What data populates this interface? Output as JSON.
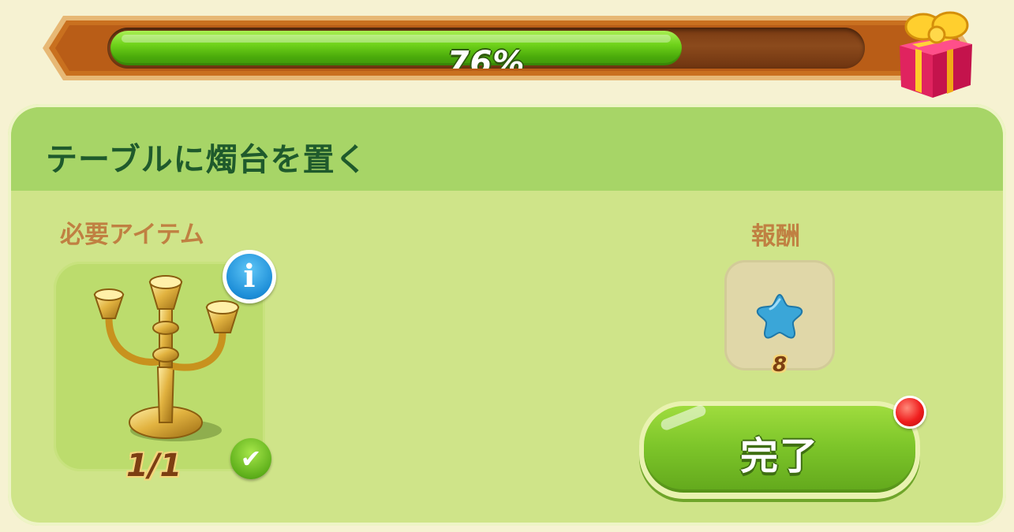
{
  "progress": {
    "percent_text": "76%",
    "fraction": 0.76
  },
  "task": {
    "title": "テーブルに燭台を置く",
    "required_items_label": "必要アイテム",
    "reward_label": "報酬",
    "item": {
      "icon": "candelabra-icon",
      "count_text": "1/1",
      "completed": true
    },
    "reward": {
      "icon": "blue-star-icon",
      "amount": "8"
    },
    "complete_button_label": "完了",
    "has_notification": true
  },
  "colors": {
    "progress_fill": "#6fd21a",
    "panel_bg": "#cfe489",
    "header_bg": "#a7d567",
    "title_text": "#1f5a2c",
    "section_label": "#c08042",
    "button_green": "#7ec62a",
    "notification_red": "#f01e1e",
    "info_blue": "#1d8ed8",
    "star_blue": "#3aa6d8"
  }
}
